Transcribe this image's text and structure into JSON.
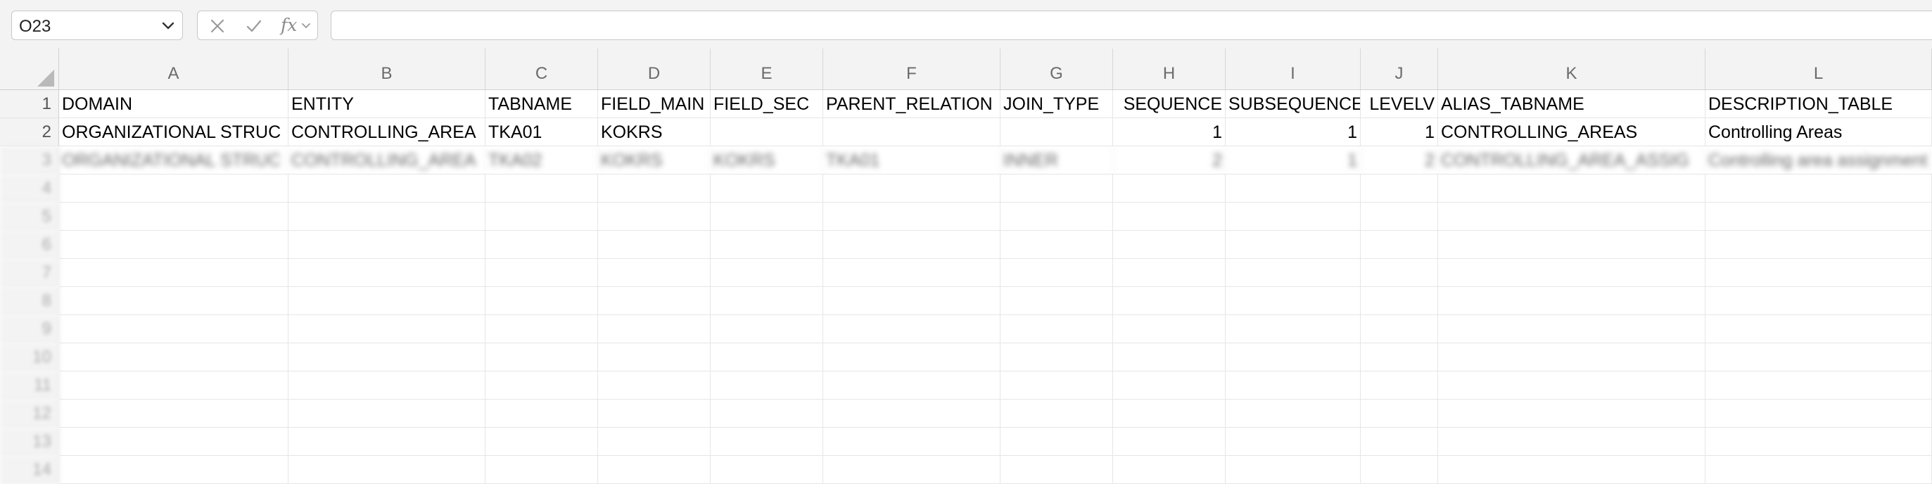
{
  "formula_bar": {
    "name_box": "O23",
    "fx_label": "fx",
    "formula": ""
  },
  "columns": [
    "A",
    "B",
    "C",
    "D",
    "E",
    "F",
    "G",
    "H",
    "I",
    "J",
    "K",
    "L"
  ],
  "row_numbers": [
    "1",
    "2",
    "3",
    "4",
    "5",
    "6",
    "7",
    "8",
    "9",
    "10",
    "11",
    "12",
    "13",
    "14"
  ],
  "rows": [
    [
      "DOMAIN",
      "ENTITY",
      "TABNAME",
      "FIELD_MAIN",
      "FIELD_SEC",
      "PARENT_RELATION",
      "JOIN_TYPE",
      "SEQUENCE",
      "SUBSEQUENCE",
      "LEVELV",
      "ALIAS_TABNAME",
      "DESCRIPTION_TABLE"
    ],
    [
      "ORGANIZATIONAL STRUC",
      "CONTROLLING_AREA",
      "TKA01",
      "KOKRS",
      "",
      "",
      "",
      "1",
      "1",
      "1",
      "CONTROLLING_AREAS",
      "Controlling Areas"
    ],
    [
      "ORGANIZATIONAL STRUC",
      "CONTROLLING_AREA",
      "TKA02",
      "KOKRS",
      "KOKRS",
      "TKA01",
      "INNER",
      "2",
      "1",
      "2",
      "CONTROLLING_AREA_ASSIG",
      "Controlling area assignment"
    ]
  ]
}
